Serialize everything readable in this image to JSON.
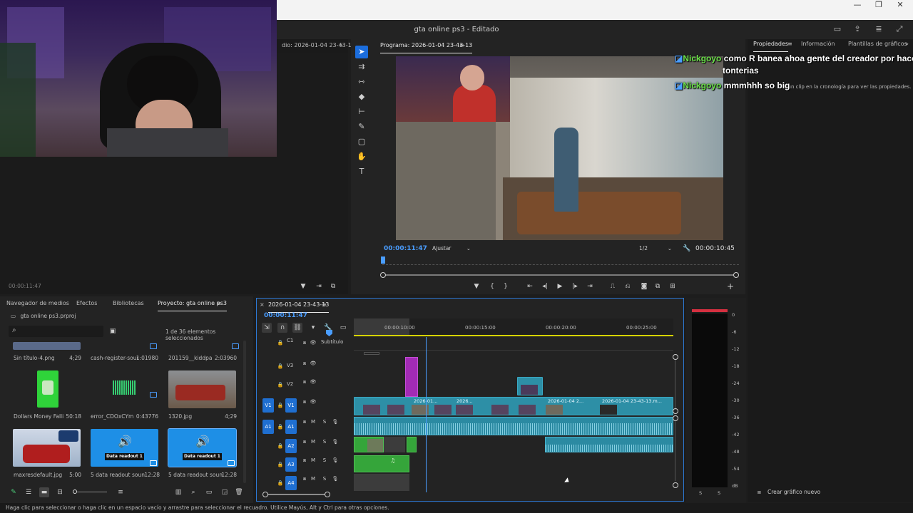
{
  "window": {
    "controls": [
      "—",
      "❐",
      "✕"
    ]
  },
  "titlebar": {
    "title": "gta online ps3 - Editado"
  },
  "source_monitor": {
    "title": "dio: 2026-01-04 23-43-13",
    "timecode": "00:00:11:47"
  },
  "program": {
    "title": "Programa: 2026-01-04 23-43-13",
    "timecode_left": "00:00:11:47",
    "fit": "Ajustar",
    "resolution": "1/2",
    "timecode_right": "00:00:10:45"
  },
  "chat": [
    {
      "user": "Nickgoyo",
      "message": "como R banea ahoa gente del creador por hacer",
      "cont": "tonterias"
    },
    {
      "user": "Nickgoyo",
      "message": "mmmhhh so big"
    }
  ],
  "properties": {
    "tabs": [
      "Propiedades",
      "Información",
      "Plantillas de gráficos"
    ],
    "hint": "e un clip en la cronología para ver las propiedades.",
    "new_graphic": "Crear gráfico nuevo"
  },
  "project": {
    "tabs": [
      "Navegador de medios",
      "Efectos",
      "Bibliotecas",
      "Proyecto: gta online ps3"
    ],
    "file": "gta online ps3.prproj",
    "count": "1 de 36 elementos seleccionados",
    "items": [
      {
        "name": "Sin título-4.png",
        "duration": "4;29"
      },
      {
        "name": "cash-register-soun...",
        "duration": "1:01980"
      },
      {
        "name": "201159__kiddpar...",
        "duration": "2:03960"
      },
      {
        "name": "Dollars Money Fallin...",
        "duration": "50:18"
      },
      {
        "name": "error_CDOxCYm...",
        "duration": "0:43776"
      },
      {
        "name": "1320.jpg",
        "duration": "4;29"
      },
      {
        "name": "maxresdefault.jpg",
        "duration": "5:00"
      },
      {
        "name": "5 data readout sound...",
        "duration": "12:28"
      },
      {
        "name": "5 data readout sound...",
        "duration": "12:28"
      }
    ],
    "readout_label": "Data readout 1"
  },
  "timeline": {
    "tab": "2026-01-04 23-43-13",
    "timecode": "00:00:11:47",
    "ruler": [
      "00:00:10:00",
      "00:00:15:00",
      "00:00:20:00",
      "00:00:25:00"
    ],
    "tracks_video": [
      {
        "id": "C1",
        "name": "Subtítulo"
      },
      {
        "id": "V3",
        "name": ""
      },
      {
        "id": "V2",
        "name": ""
      },
      {
        "id": "V1",
        "name": ""
      }
    ],
    "tracks_audio": [
      "A1",
      "A2",
      "A3",
      "A4"
    ],
    "src_v1": "V1",
    "src_a1": "A1",
    "clip_labels": [
      "2026-01...",
      "2026...",
      "2026-01-04 2...",
      "2026-01-04 23-43-13.m..."
    ],
    "mute": "M",
    "solo": "S"
  },
  "meter": {
    "scale": [
      "0",
      "-6",
      "-12",
      "-18",
      "-24",
      "-30",
      "-36",
      "-42",
      "-48",
      "-54",
      "dB"
    ],
    "solo": [
      "S",
      "S"
    ]
  },
  "status_bar": "Haga clic para seleccionar o haga clic en un espacio vacío y arrastre para seleccionar el recuadro. Utilice Mayús, Alt y Ctrl para otras opciones.",
  "colors": {
    "accent": "#1b6ddd",
    "clip": "#2d8fa6",
    "audio_green": "#35a53a",
    "chat_user": "#6be24a",
    "playhead": "#4a9dff"
  }
}
